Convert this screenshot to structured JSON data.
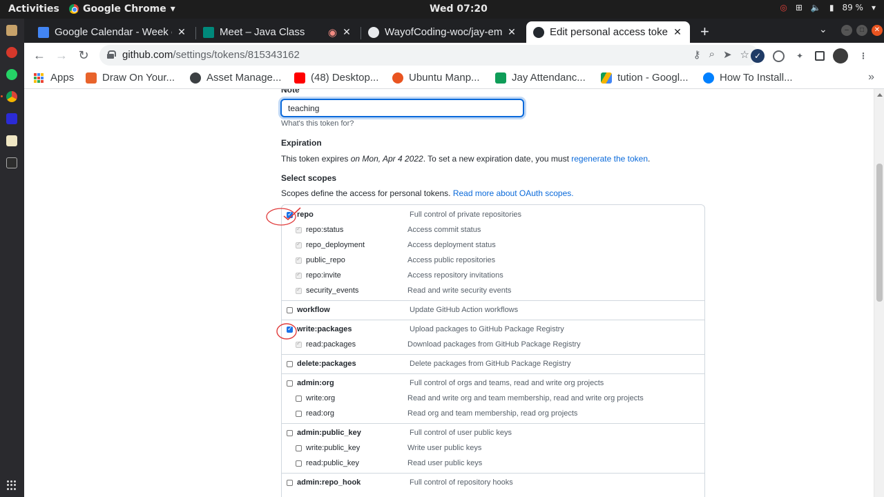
{
  "system": {
    "activities": "Activities",
    "app_name": "Google Chrome",
    "clock": "Wed 07:20",
    "battery": "89 %"
  },
  "tabs": [
    {
      "title": "Google Calendar - Week o",
      "favicon_color": "#4285f4"
    },
    {
      "title": "Meet – Java Class",
      "favicon_color": "#00897b"
    },
    {
      "title": "WayofCoding-woc/jay-em",
      "favicon_color": "#24292f"
    },
    {
      "title": "Edit personal access toke",
      "favicon_color": "#24292f"
    }
  ],
  "toolbar": {
    "url_host": "github.com",
    "url_path": "/settings/tokens/815343162"
  },
  "bookmarks": [
    {
      "label": "Apps",
      "icon_color": "#ea4335"
    },
    {
      "label": "Draw On Your...",
      "icon_color": "#e8632b"
    },
    {
      "label": "Asset Manage...",
      "icon_color": "#3c4043"
    },
    {
      "label": "(48) Desktop...",
      "icon_color": "#ff0000"
    },
    {
      "label": "Ubuntu Manp...",
      "icon_color": "#e95420"
    },
    {
      "label": "Jay Attendanc...",
      "icon_color": "#0f9d58"
    },
    {
      "label": "tution - Googl...",
      "icon_color": "#f4b400"
    },
    {
      "label": "How To Install...",
      "icon_color": "#0080ff"
    }
  ],
  "form": {
    "note_label": "Note",
    "note_value": "teaching",
    "note_hint": "What's this token for?",
    "expiration_heading": "Expiration",
    "expiration_prefix": "This token expires ",
    "expiration_date": "on Mon, Apr 4 2022",
    "expiration_middle": ". To set a new expiration date, you must ",
    "expiration_link": "regenerate the token",
    "expiration_suffix": ".",
    "scopes_heading": "Select scopes",
    "scopes_desc": "Scopes define the access for personal tokens. ",
    "scopes_link": "Read more about OAuth scopes."
  },
  "scopes": [
    {
      "name": "repo",
      "desc": "Full control of private repositories",
      "state": "checked",
      "children": [
        {
          "name": "repo:status",
          "desc": "Access commit status",
          "state": "implied"
        },
        {
          "name": "repo_deployment",
          "desc": "Access deployment status",
          "state": "implied"
        },
        {
          "name": "public_repo",
          "desc": "Access public repositories",
          "state": "implied"
        },
        {
          "name": "repo:invite",
          "desc": "Access repository invitations",
          "state": "implied"
        },
        {
          "name": "security_events",
          "desc": "Read and write security events",
          "state": "implied"
        }
      ]
    },
    {
      "name": "workflow",
      "desc": "Update GitHub Action workflows",
      "state": "unchecked",
      "children": []
    },
    {
      "name": "write:packages",
      "desc": "Upload packages to GitHub Package Registry",
      "state": "checked",
      "children": [
        {
          "name": "read:packages",
          "desc": "Download packages from GitHub Package Registry",
          "state": "implied"
        }
      ]
    },
    {
      "name": "delete:packages",
      "desc": "Delete packages from GitHub Package Registry",
      "state": "unchecked",
      "children": []
    },
    {
      "name": "admin:org",
      "desc": "Full control of orgs and teams, read and write org projects",
      "state": "unchecked",
      "children": [
        {
          "name": "write:org",
          "desc": "Read and write org and team membership, read and write org projects",
          "state": "unchecked"
        },
        {
          "name": "read:org",
          "desc": "Read org and team membership, read org projects",
          "state": "unchecked"
        }
      ]
    },
    {
      "name": "admin:public_key",
      "desc": "Full control of user public keys",
      "state": "unchecked",
      "children": [
        {
          "name": "write:public_key",
          "desc": "Write user public keys",
          "state": "unchecked"
        },
        {
          "name": "read:public_key",
          "desc": "Read user public keys",
          "state": "unchecked"
        }
      ]
    },
    {
      "name": "admin:repo_hook",
      "desc": "Full control of repository hooks",
      "state": "unchecked",
      "children": []
    }
  ]
}
